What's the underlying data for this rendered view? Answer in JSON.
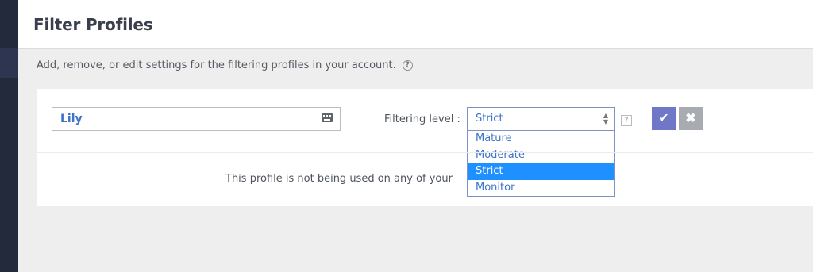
{
  "page_title": "Filter Profiles",
  "description": "Add, remove, or edit settings for the filtering profiles in your account.",
  "description_help_icon": "?",
  "profile": {
    "name_value": "Lily",
    "filtering_label": "Filtering level :",
    "selected_level": "Strict",
    "level_options": [
      "Mature",
      "Moderate",
      "Strict",
      "Monitor"
    ],
    "help_icon": "?",
    "usage_text": "This profile is not being used on any of your"
  },
  "icons": {
    "keyboard": "keyboard-icon",
    "confirm": "check-icon",
    "cancel": "close-icon",
    "help": "question-icon"
  },
  "colors": {
    "accent": "#6f77c6",
    "link": "#3d74c9",
    "selected_option": "#1e90ff",
    "sidebar": "#232a3b"
  }
}
